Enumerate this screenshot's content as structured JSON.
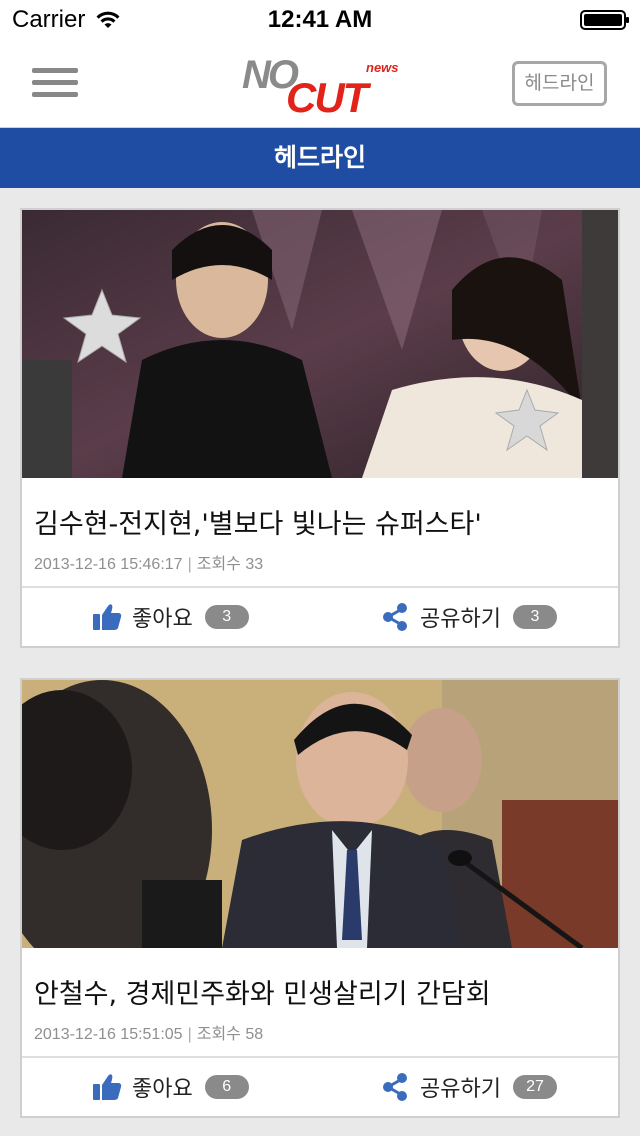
{
  "status_bar": {
    "carrier": "Carrier",
    "time": "12:41 AM"
  },
  "nav": {
    "logo_text_top": "NO",
    "logo_text_bottom": "CUT",
    "logo_superscript": "news",
    "headline_button": "헤드라인"
  },
  "section": {
    "title": "헤드라인"
  },
  "colors": {
    "accent_blue": "#1f4da3",
    "logo_gray": "#8a8a8a",
    "logo_red": "#e2231a",
    "icon_blue": "#3a6bbd"
  },
  "articles": [
    {
      "title": "김수현-전지현,'별보다 빛나는 슈퍼스타'",
      "date": "2013-12-16 15:46:17",
      "views_label": "조회수 33",
      "like_label": "좋아요",
      "like_count": "3",
      "share_label": "공유하기",
      "share_count": "3",
      "image_icon": "photo-two-people-holding-stars"
    },
    {
      "title": "안철수, 경제민주화와 민생살리기 간담회",
      "date": "2013-12-16 15:51:05",
      "views_label": "조회수 58",
      "like_label": "좋아요",
      "like_count": "6",
      "share_label": "공유하기",
      "share_count": "27",
      "image_icon": "photo-man-speaking-at-microphone"
    }
  ]
}
